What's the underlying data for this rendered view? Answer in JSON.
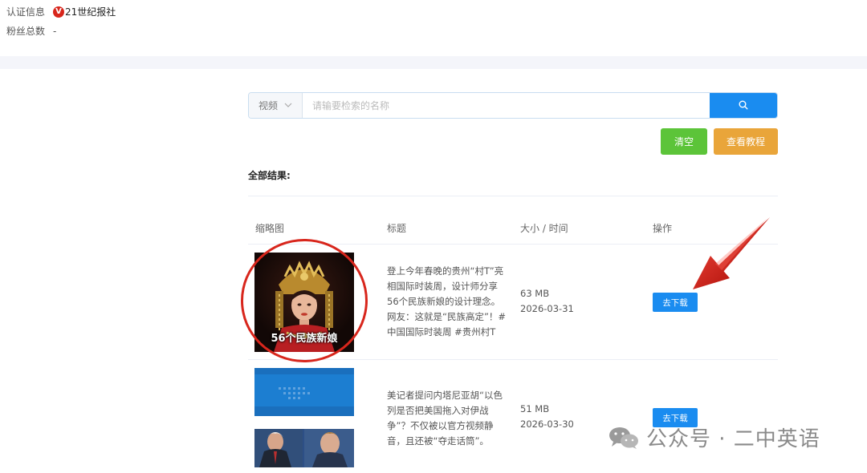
{
  "profile": {
    "cert_label": "认证信息",
    "cert_badge": "V",
    "cert_name": "21世纪报社",
    "fans_label": "粉丝总数",
    "fans_value": "-"
  },
  "search": {
    "type_selected": "视频",
    "placeholder": "请输要检索的名称",
    "value": ""
  },
  "actions": {
    "clear_label": "清空",
    "tutorial_label": "查看教程"
  },
  "results": {
    "heading": "全部结果:",
    "columns": [
      "缩略图",
      "标题",
      "大小 / 时间",
      "操作"
    ],
    "rows": [
      {
        "thumb_caption": "56个民族新娘",
        "title": "登上今年春晚的贵州“村T”亮相国际时装周，设计师分享56个民族新娘的设计理念。网友：这就是“民族高定”！#中国国际时装周 #贵州村T",
        "size": "63 MB",
        "date": "2026-03-31",
        "action_label": "去下载"
      },
      {
        "thumb_caption": "",
        "title": "美记者提问内塔尼亚胡“以色列是否把美国拖入对伊战争”？不仅被以官方视频静音，且还被“夺走话筒”。",
        "size": "51 MB",
        "date": "2026-03-30",
        "action_label": "去下载"
      }
    ]
  },
  "watermark": {
    "text": "公众号 · 二中英语"
  },
  "colors": {
    "primary": "#1a8cf0",
    "clear": "#5cc439",
    "tutorial": "#e9a53a",
    "annotation": "#d8261c"
  }
}
